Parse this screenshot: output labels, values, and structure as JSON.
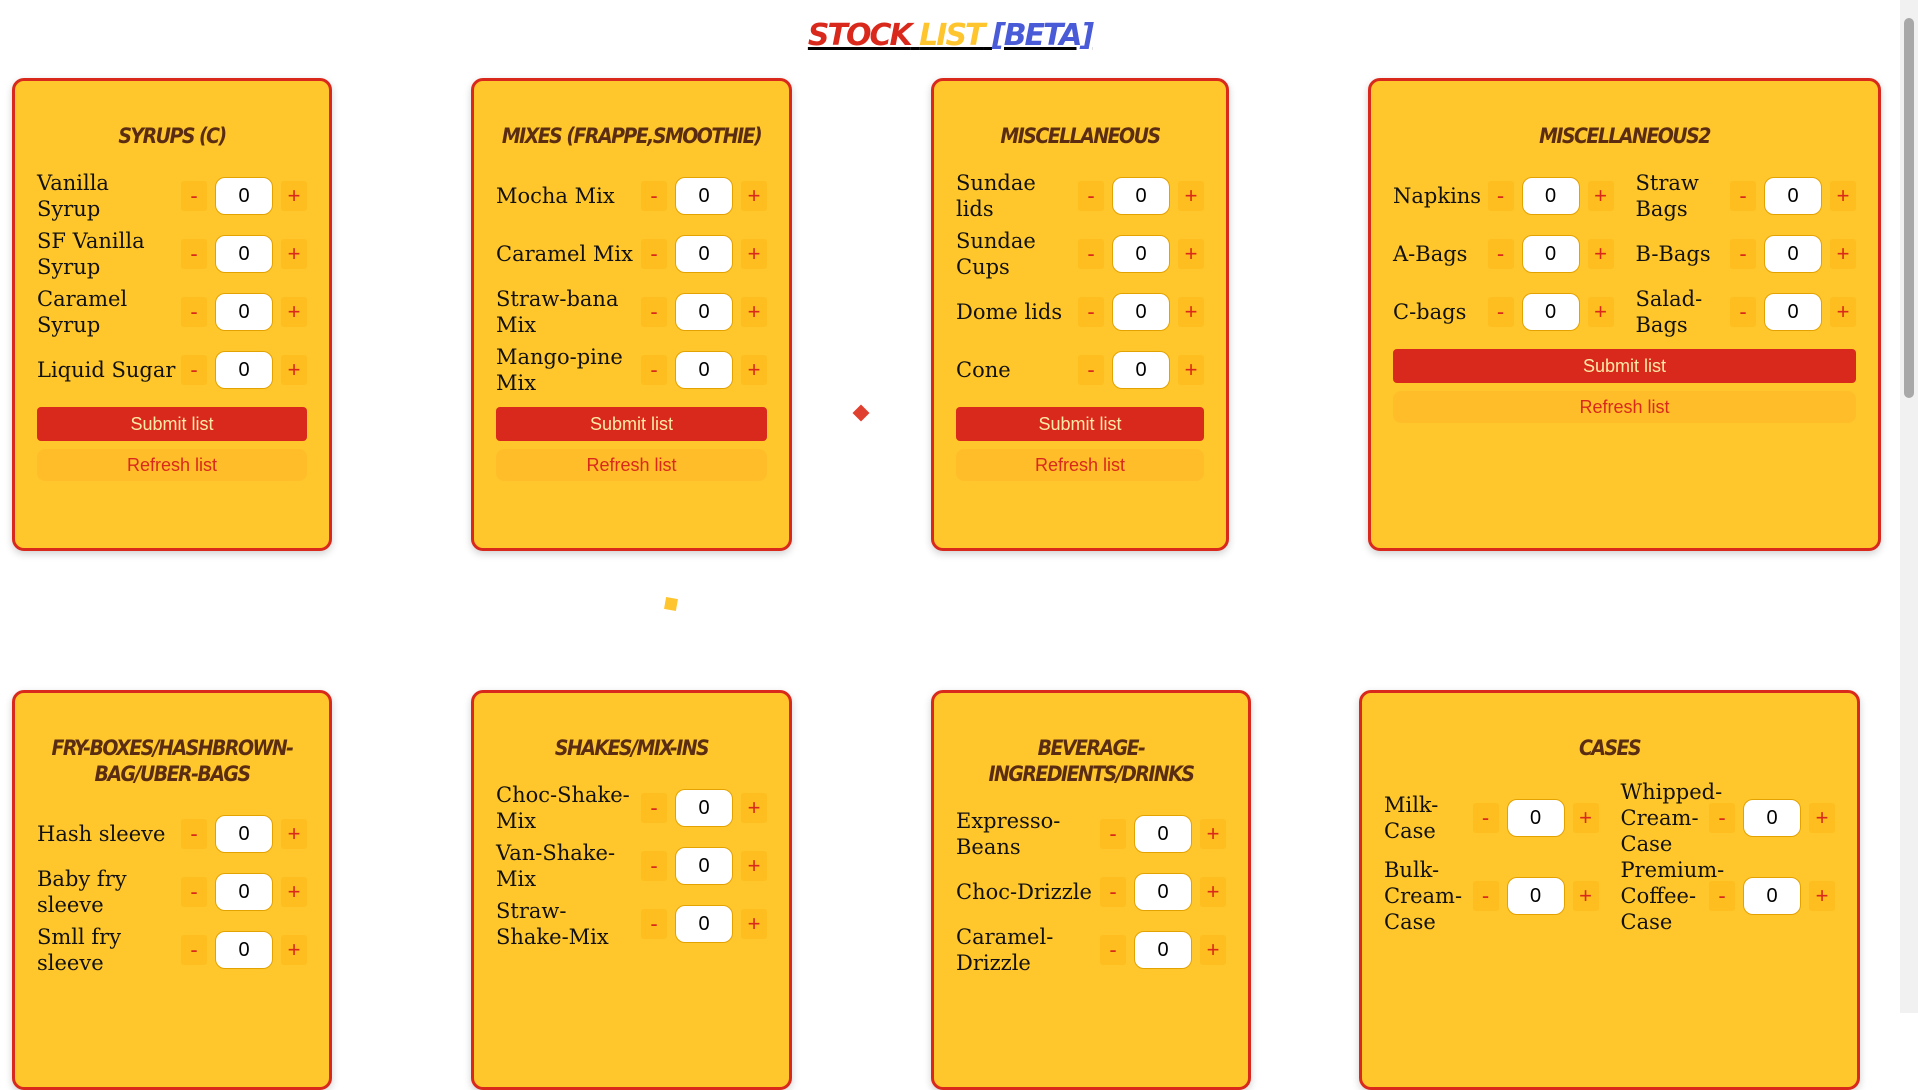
{
  "title": {
    "part1": "STOCK",
    "part2": "LIST",
    "part3": "[BETA]"
  },
  "buttons": {
    "submit": "Submit list",
    "refresh": "Refresh list",
    "minus": "-",
    "plus": "+"
  },
  "cards": [
    {
      "title": "SYRUPS (C)",
      "items": [
        {
          "label": "Vanilla Syrup",
          "value": "0"
        },
        {
          "label": "SF Vanilla Syrup",
          "value": "0"
        },
        {
          "label": "Caramel Syrup",
          "value": "0"
        },
        {
          "label": "Liquid Sugar",
          "value": "0"
        }
      ]
    },
    {
      "title": "MIXES (FRAPPE,SMOOTHIE)",
      "items": [
        {
          "label": "Mocha Mix",
          "value": "0"
        },
        {
          "label": "Caramel Mix",
          "value": "0"
        },
        {
          "label": "Straw-bana Mix",
          "value": "0"
        },
        {
          "label": "Mango-pine Mix",
          "value": "0"
        }
      ]
    },
    {
      "title": "MISCELLANEOUS",
      "items": [
        {
          "label": "Sundae lids",
          "value": "0"
        },
        {
          "label": "Sundae Cups",
          "value": "0"
        },
        {
          "label": "Dome lids",
          "value": "0"
        },
        {
          "label": "Cone",
          "value": "0"
        }
      ]
    },
    {
      "title": "MISCELLANEOUS2",
      "items": [
        {
          "label": "Napkins",
          "value": "0"
        },
        {
          "label": "Straw Bags",
          "value": "0"
        },
        {
          "label": "A-Bags",
          "value": "0"
        },
        {
          "label": "B-Bags",
          "value": "0"
        },
        {
          "label": "C-bags",
          "value": "0"
        },
        {
          "label": "Salad-Bags",
          "value": "0"
        }
      ]
    },
    {
      "title": "FRY-BOXES/HASHBROWN-BAG/UBER-BAGS",
      "items": [
        {
          "label": "Hash sleeve",
          "value": "0"
        },
        {
          "label": "Baby fry sleeve",
          "value": "0"
        },
        {
          "label": "Smll fry sleeve",
          "value": "0"
        }
      ]
    },
    {
      "title": "SHAKES/MIX-INS",
      "items": [
        {
          "label": "Choc-Shake-Mix",
          "value": "0"
        },
        {
          "label": "Van-Shake-Mix",
          "value": "0"
        },
        {
          "label": "Straw-Shake-Mix",
          "value": "0"
        }
      ]
    },
    {
      "title": "BEVERAGE-INGREDIENTS/DRINKS",
      "items": [
        {
          "label": "Expresso-Beans",
          "value": "0"
        },
        {
          "label": "Choc-Drizzle",
          "value": "0"
        },
        {
          "label": "Caramel-Drizzle",
          "value": "0"
        }
      ]
    },
    {
      "title": "CASES",
      "items": [
        {
          "label": "Milk-Case",
          "value": "0"
        },
        {
          "label": "Whipped-Cream-Case",
          "value": "0"
        },
        {
          "label": "Bulk-Cream-Case",
          "value": "0"
        },
        {
          "label": "Premium-Coffee-Case",
          "value": "0"
        }
      ]
    }
  ],
  "colors": {
    "accent": "#d9291c",
    "card": "#ffc72c",
    "title_brown": "#5a2d12",
    "beta_blue": "#4a5bd8"
  }
}
